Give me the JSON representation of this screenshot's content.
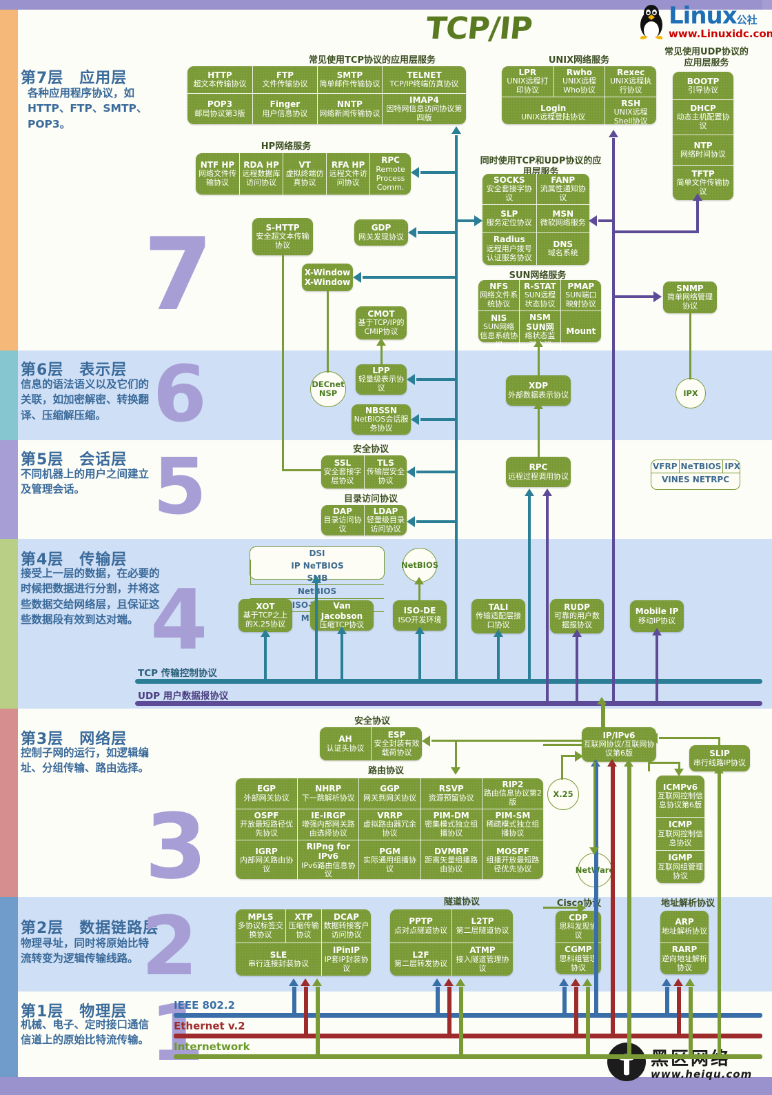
{
  "title": "TCP/IP",
  "brand": {
    "linux_name": "Linux",
    "linux_cn": "公社",
    "linux_url": "www.Linuxidc.com",
    "heiqu_cn": "黑区网络",
    "heiqu_url": "www.heiqu.com"
  },
  "layers": [
    {
      "id": "l7",
      "title": "第7层　应用层",
      "desc": "各种应用程序协议，如HTTP、FTP、SMTP、POP3。",
      "number": "7"
    },
    {
      "id": "l6",
      "title": "第6层　表示层",
      "desc": "信息的语法语义以及它们的关联，如加密解密、转换翻译、压缩解压缩。",
      "number": "6"
    },
    {
      "id": "l5",
      "title": "第5层　会话层",
      "desc": "不同机器上的用户之间建立及管理会话。",
      "number": "5"
    },
    {
      "id": "l4",
      "title": "第4层　传输层",
      "desc": "接受上一层的数据，在必要的时候把数据进行分割，并将这些数据交给网络层，且保证这些数据段有效到达对端。",
      "number": "4"
    },
    {
      "id": "l3",
      "title": "第3层　网络层",
      "desc": "控制子网的运行，如逻辑编址、分组传输、路由选择。",
      "number": "3"
    },
    {
      "id": "l2",
      "title": "第2层　数据链路层",
      "desc": "物理寻址，同时将原始比特流转变为逻辑传输线路。",
      "number": "2"
    },
    {
      "id": "l1",
      "title": "第1层　物理层",
      "desc": "机械、电子、定时接口通信信道上的原始比特流传输。",
      "number": "1"
    }
  ],
  "captions": {
    "tcp_app": "常见使用TCP协议的应用层服务",
    "unix": "UNIX网络服务",
    "udp_app": "常见使用UDP协议的应用层服务",
    "hp": "HP网络服务",
    "both": "同时使用TCP和UDP协议的应用层服务",
    "sun": "SUN网络服务",
    "security5": "安全协议",
    "directory": "目录访问协议",
    "security3": "安全协议",
    "routing": "路由协议",
    "tunnel": "隧道协议",
    "cisco": "Cisco协议",
    "arp": "地址解析协议"
  },
  "tcp_app_group": [
    {
      "nm": "HTTP",
      "cn": "超文本传输协议"
    },
    {
      "nm": "FTP",
      "cn": "文件传输协议"
    },
    {
      "nm": "SMTP",
      "cn": "简单邮件传输协议"
    },
    {
      "nm": "TELNET",
      "cn": "TCP/IP终端仿真协议"
    },
    {
      "nm": "POP3",
      "cn": "邮局协议第3版"
    },
    {
      "nm": "Finger",
      "cn": "用户信息协议"
    },
    {
      "nm": "NNTP",
      "cn": "网络新闻传输协议"
    },
    {
      "nm": "IMAP4",
      "cn": "因特网信息访问协议第四版"
    }
  ],
  "unix_group": [
    {
      "nm": "LPR",
      "cn": "UNIX远程打印协议"
    },
    {
      "nm": "Rwho",
      "cn": "UNIX远程Who协议"
    },
    {
      "nm": "Rexec",
      "cn": "UNIX远程执行协议"
    },
    {
      "nm": "Login",
      "cn": "UNIX远程登陆协议"
    },
    {
      "nm": "RSH",
      "cn": "UNIX远程Shell协议"
    }
  ],
  "udp_app_group": [
    {
      "nm": "BOOTP",
      "cn": "引导协议"
    },
    {
      "nm": "DHCP",
      "cn": "动态主机配置协议"
    },
    {
      "nm": "NTP",
      "cn": "网络时间协议"
    },
    {
      "nm": "TFTP",
      "cn": "简单文件传输协议"
    }
  ],
  "hp_group": [
    {
      "nm": "NTF HP",
      "cn": "网络文件传输协议"
    },
    {
      "nm": "RDA HP",
      "cn": "远程数据库访问协议"
    },
    {
      "nm": "VT",
      "cn": "虚拟终端仿真协议"
    },
    {
      "nm": "RFA HP",
      "cn": "远程文件访问协议"
    },
    {
      "nm": "RPC",
      "cn": "Remote Process Comm."
    }
  ],
  "both_group": [
    {
      "nm": "SOCKS",
      "cn": "安全套接字协议"
    },
    {
      "nm": "FANP",
      "cn": "流属性通知协议"
    },
    {
      "nm": "SLP",
      "cn": "服务定位协议"
    },
    {
      "nm": "MSN",
      "cn": "微软网络服务"
    },
    {
      "nm": "Radius",
      "cn": "远程用户拨号认证服务协议"
    },
    {
      "nm": "DNS",
      "cn": "域名系统"
    }
  ],
  "sun_group": [
    {
      "nm": "NFS",
      "cn": "网络文件系统协议"
    },
    {
      "nm": "R-STAT",
      "cn": "SUN远程状态协议"
    },
    {
      "nm": "PMAP",
      "cn": "SUN端口映射协议"
    },
    {
      "nm": "NIS",
      "cn": "SUN网络信息系统协议"
    },
    {
      "nm": "NSM SUN网",
      "cn": "络状态监测协议"
    },
    {
      "nm": "Mount",
      "cn": ""
    }
  ],
  "standalone": {
    "shttp": {
      "nm": "S-HTTP",
      "cn": "安全超文本传输协议"
    },
    "gdp": {
      "nm": "GDP",
      "cn": "网关发现协议"
    },
    "xwindow": {
      "nm": "X-Window",
      "cn": "X-Window"
    },
    "cmot": {
      "nm": "CMOT",
      "cn": "基于TCP/IP的CMIP协议"
    },
    "snmp": {
      "nm": "SNMP",
      "cn": "简单网络管理协议"
    },
    "lpp": {
      "nm": "LPP",
      "cn": "轻量级表示协议"
    },
    "nbssn": {
      "nm": "NBSSN",
      "cn": "NetBIOS会话服务协议"
    },
    "xdp": {
      "nm": "XDP",
      "cn": "外部数据表示协议"
    },
    "rpc5": {
      "nm": "RPC",
      "cn": "远程过程调用协议"
    },
    "decnet": {
      "nm": "DECnet",
      "cn": "NSP"
    },
    "ipx": {
      "nm": "IPX",
      "cn": ""
    },
    "netbios_circle": {
      "nm": "NetBIOS",
      "cn": ""
    },
    "x25": {
      "nm": "X.25",
      "cn": ""
    },
    "netware": {
      "nm": "NetWare",
      "cn": ""
    },
    "xot": {
      "nm": "XOT",
      "cn": "基于TCP之上的X.25协议"
    },
    "vanjacobson": {
      "nm": "Van Jacobson",
      "cn": "压缩TCP协议"
    },
    "isode": {
      "nm": "ISO-DE",
      "cn": "ISO开发环境"
    },
    "tali": {
      "nm": "TALI",
      "cn": "传输适配层接口协议"
    },
    "rudp": {
      "nm": "RUDP",
      "cn": "可靠的用户数据报协议"
    },
    "mobileip": {
      "nm": "Mobile IP",
      "cn": "移动IP协议"
    },
    "ipipv6": {
      "nm": "IP/IPv6",
      "cn": "互联网协议/互联网协议第6版"
    },
    "slip": {
      "nm": "SLIP",
      "cn": "串行线路IP协议"
    }
  },
  "session_sec": [
    {
      "nm": "SSL",
      "cn": "安全套接字层协议"
    },
    {
      "nm": "TLS",
      "cn": "传输层安全协议"
    }
  ],
  "session_dir": [
    {
      "nm": "DAP",
      "cn": "目录访问协议"
    },
    {
      "nm": "LDAP",
      "cn": "轻量级目录访问协议"
    }
  ],
  "vines_group": {
    "cells": [
      "VFRP",
      "NeTBIOS",
      "IPX"
    ],
    "footer": "VINES NETRPC"
  },
  "l4_white_group": [
    "DSI",
    "IP NeTBIOS",
    "SMB",
    "NetBIOS",
    "ISO-TP SSP",
    "MSRPC"
  ],
  "bus": {
    "tcp": "TCP 传输控制协议",
    "udp": "UDP 用户数据报协议"
  },
  "l3_security": [
    {
      "nm": "AH",
      "cn": "认证头协议"
    },
    {
      "nm": "ESP",
      "cn": "安全封装有效载荷协议"
    }
  ],
  "routing_group": [
    {
      "nm": "EGP",
      "cn": "外部网关协议"
    },
    {
      "nm": "NHRP",
      "cn": "下一跳解析协议"
    },
    {
      "nm": "GGP",
      "cn": "网关到网关协议"
    },
    {
      "nm": "RSVP",
      "cn": "资源预留协议"
    },
    {
      "nm": "RIP2",
      "cn": "路由信息协议第2版"
    },
    {
      "nm": "OSPF",
      "cn": "开放最短路径优先协议"
    },
    {
      "nm": "IE-IRGP",
      "cn": "增强内部网关路由选择协议"
    },
    {
      "nm": "VRRP",
      "cn": "虚拟路由器冗余协议"
    },
    {
      "nm": "PIM-DM",
      "cn": "密集模式独立组播协议"
    },
    {
      "nm": "PIM-SM",
      "cn": "稀疏模式独立组播协议"
    },
    {
      "nm": "IGRP",
      "cn": "内部网关路由协议"
    },
    {
      "nm": "RIPng for IPv6",
      "cn": "IPv6路由信息协议"
    },
    {
      "nm": "PGM",
      "cn": "实际通用组播协议"
    },
    {
      "nm": "DVMRP",
      "cn": "距离矢量组播路由协议"
    },
    {
      "nm": "MOSPF",
      "cn": "组播开放最短路径优先协议"
    }
  ],
  "icmp_group": [
    {
      "nm": "ICMPv6",
      "cn": "互联网控制信息协议第6版"
    },
    {
      "nm": "ICMP",
      "cn": "互联网控制信息协议"
    },
    {
      "nm": "IGMP",
      "cn": "互联网组管理协议"
    }
  ],
  "l2_left_group": [
    {
      "nm": "MPLS",
      "cn": "多协议标签交换协议"
    },
    {
      "nm": "XTP",
      "cn": "压缩传输协议"
    },
    {
      "nm": "DCAP",
      "cn": "数据转接客户访问协议"
    },
    {
      "nm": "SLE",
      "cn": "串行连接封装协议"
    },
    {
      "nm": "IPinIP",
      "cn": "IP套IP封装协议"
    }
  ],
  "tunnel_group": [
    {
      "nm": "PPTP",
      "cn": "点对点隧道协议"
    },
    {
      "nm": "L2TP",
      "cn": "第二层隧道协议"
    },
    {
      "nm": "L2F",
      "cn": "第二层转发协议"
    },
    {
      "nm": "ATMP",
      "cn": "接入隧道管理协议"
    }
  ],
  "cisco_group": [
    {
      "nm": "CDP",
      "cn": "思科发现协议"
    },
    {
      "nm": "CGMP",
      "cn": "思科组管理协议"
    }
  ],
  "arp_group": [
    {
      "nm": "ARP",
      "cn": "地址解析协议"
    },
    {
      "nm": "RARP",
      "cn": "逆向地址解析协议"
    }
  ],
  "physical": [
    {
      "label": "IEEE 802.2",
      "color": "#3a6ea8"
    },
    {
      "label": "Ethernet v.2",
      "color": "#9e2b2b"
    },
    {
      "label": "Internetwork",
      "color": "#7a9a36"
    }
  ],
  "colors": {
    "green_box": "#7a9a36",
    "teal_line": "#2a7f96",
    "purple_line": "#5d4b98",
    "layer_text": "#3a6a9a",
    "big_number": "#a79ed6"
  }
}
